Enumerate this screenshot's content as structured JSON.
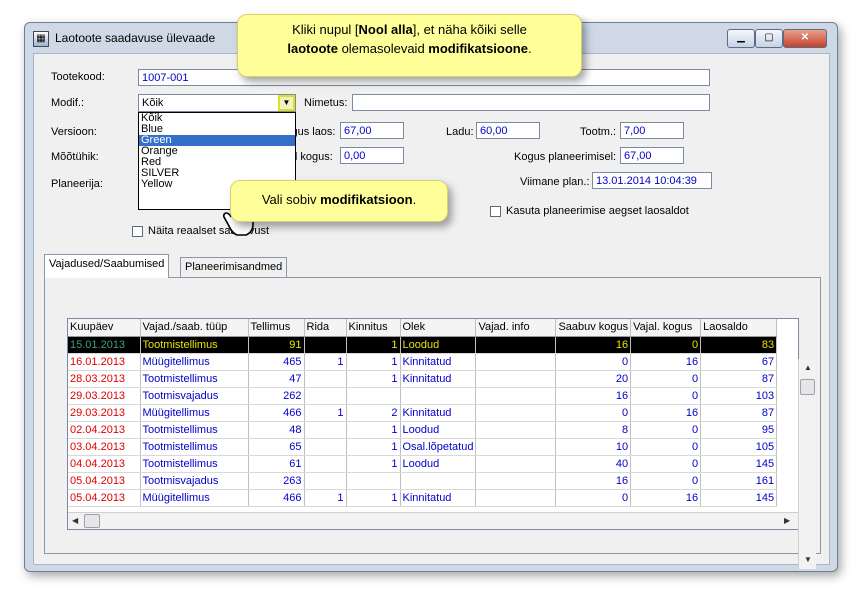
{
  "window": {
    "title": "Laotoote saadavuse ülevaade",
    "buttons": {
      "minimize": "▁",
      "maximize": "▢",
      "close": "✕"
    }
  },
  "form": {
    "tootekood_label": "Tootekood:",
    "tootekood_value": "1007-001",
    "modif_label": "Modif.:",
    "modif_value": "Kõik",
    "nimetus_label": "Nimetus:",
    "nimetus_value": "",
    "versioon_label": "Versioon:",
    "kogus_laos_label": "Kogus laos:",
    "kogus_laos_value": "67,00",
    "ladu_label": "Ladu:",
    "ladu_value": "60,00",
    "tootm_label": "Tootm.:",
    "tootm_value": "7,00",
    "mootuhik_label": "Mõõtühik:",
    "ootel_kogus_label": "Ootel kogus:",
    "ootel_kogus_value": "0,00",
    "kogus_plan_label": "Kogus planeerimisel:",
    "kogus_plan_value": "67,00",
    "planeerija_label": "Planeerija:",
    "viimane_plan_label": "Viimane plan.:",
    "viimane_plan_value": "13.01.2014 10:04:39",
    "kasuta_label": "Kasuta planeerimise aegset laosaldot",
    "naita_label": "Näita reaalset saadavust"
  },
  "dropdown": {
    "options": [
      "Kõik",
      "Blue",
      "Green",
      "Orange",
      "Red",
      "SILVER",
      "Yellow"
    ],
    "selected": "Green"
  },
  "tabs": [
    "Vajadused/Saabumised",
    "Planeerimisandmed"
  ],
  "table": {
    "columns": [
      "Kuupäev",
      "Vajad./saab. tüüp",
      "Tellimus",
      "Rida",
      "Kinnitus",
      "Olek",
      "Vajad. info",
      "Saabuv kogus",
      "Vajal. kogus",
      "Laosaldo"
    ],
    "rows": [
      [
        "15.01.2013",
        "Tootmistellimus",
        "91",
        "",
        "1",
        "Loodud",
        "",
        "16",
        "0",
        "83"
      ],
      [
        "16.01.2013",
        "Müügitellimus",
        "465",
        "1",
        "1",
        "Kinnitatud",
        "",
        "0",
        "16",
        "67"
      ],
      [
        "28.03.2013",
        "Tootmistellimus",
        "47",
        "",
        "1",
        "Kinnitatud",
        "",
        "20",
        "0",
        "87"
      ],
      [
        "29.03.2013",
        "Tootmisvajadus",
        "262",
        "",
        "",
        "",
        "",
        "16",
        "0",
        "103"
      ],
      [
        "29.03.2013",
        "Müügitellimus",
        "466",
        "1",
        "2",
        "Kinnitatud",
        "",
        "0",
        "16",
        "87"
      ],
      [
        "02.04.2013",
        "Tootmistellimus",
        "48",
        "",
        "1",
        "Loodud",
        "",
        "8",
        "0",
        "95"
      ],
      [
        "03.04.2013",
        "Tootmistellimus",
        "65",
        "",
        "1",
        "Osal.lõpetatud",
        "",
        "10",
        "0",
        "105"
      ],
      [
        "04.04.2013",
        "Tootmistellimus",
        "61",
        "",
        "1",
        "Loodud",
        "",
        "40",
        "0",
        "145"
      ],
      [
        "05.04.2013",
        "Tootmisvajadus",
        "263",
        "",
        "",
        "",
        "",
        "16",
        "0",
        "161"
      ],
      [
        "05.04.2013",
        "Müügitellimus",
        "466",
        "1",
        "1",
        "Kinnitatud",
        "",
        "0",
        "16",
        "145"
      ]
    ]
  },
  "callouts": {
    "top_1": "Kliki nupul [",
    "top_bold_1": "Nool alla",
    "top_2": "], et näha kõiki selle",
    "top_bold_2": "laotoote",
    "top_3": " olemasolevaid ",
    "top_bold_3": "modifikatsioone",
    "top_4": ".",
    "bottom_1": "Vali sobiv ",
    "bottom_bold": "modifikatsioon",
    "bottom_2": "."
  }
}
